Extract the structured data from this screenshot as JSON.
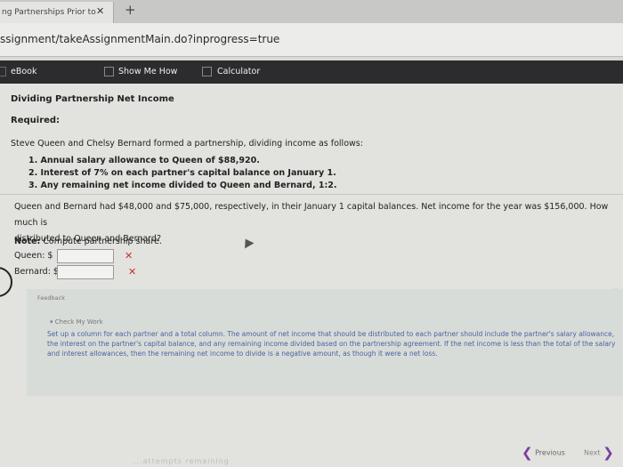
{
  "browser": {
    "tab_title": "ng Partnerships Prior to",
    "tab_close": "✕",
    "new_tab": "+",
    "url": "ssignment/takeAssignmentMain.do?inprogress=true"
  },
  "toolbar": {
    "ebook": "eBook",
    "show_me_how": "Show Me How",
    "calculator": "Calculator"
  },
  "problem": {
    "title": "Dividing Partnership Net Income",
    "required": "Required:",
    "intro": "Steve Queen and Chelsy Bernard formed a partnership, dividing income as follows:",
    "items": [
      "1. Annual salary allowance to Queen of $88,920.",
      "2. Interest of 7% on each partner's capital balance on January 1.",
      "3. Any remaining net income divided to Queen and Bernard, 1:2."
    ],
    "question_line1": "Queen and Bernard had $48,000 and $75,000, respectively, in their January 1 capital balances. Net income for the year was $156,000. How much is",
    "question_line2": "distributed to Queen and Bernard?",
    "note_label": "Note:",
    "note_text": "Compute partnership share.",
    "queen_label": "Queen: $",
    "queen_value": "",
    "bernard_label": "Bernard: $",
    "bernard_value": "",
    "wrong_mark": "✕"
  },
  "feedback": {
    "label": "Feedback",
    "check_my_work": "▾ Check My Work",
    "text": "Set up a column for each partner and a total column. The amount of net income that should be distributed to each partner should include the partner's salary allowance, the interest on the partner's capital balance, and any remaining income divided based on the partnership agreement. If the net income is less than the total of the salary and interest allowances, then the remaining net income to divide is a negative amount, as though it were a net loss."
  },
  "nav": {
    "previous": "Previous",
    "next": "Next",
    "bottom_faint": "...attempts remaining"
  }
}
